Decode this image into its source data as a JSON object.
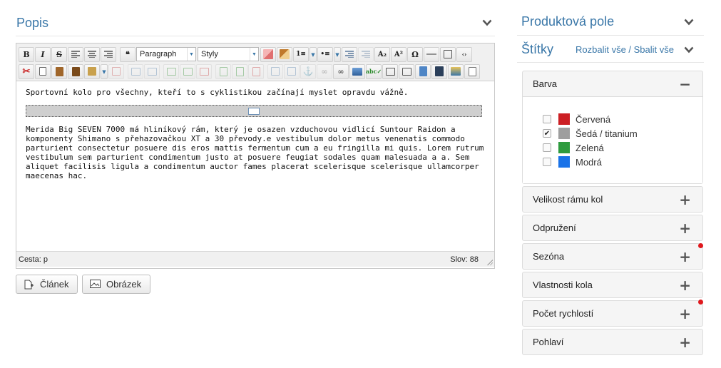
{
  "left": {
    "title": "Popis",
    "toolbar": {
      "format_select": "Paragraph",
      "style_select": "Styly"
    },
    "content": {
      "intro": "Sportovní kolo pro všechny, kteří to s cyklistikou začínají myslet opravdu vážně.",
      "body": "Merida Big SEVEN 7000 má hliníkový rám, který je osazen vzduchovou vidlicí Suntour Raidon a komponenty Shimano s přehazovačkou XT a 30 převody.e vestibulum dolor metus venenatis commodo parturient consectetur posuere dis eros mattis fermentum cum a eu fringilla mi quis. Lorem rutrum vestibulum sem parturient condimentum justo at posuere feugiat sodales quam malesuada a a. Sem aliquet facilisis ligula a condimentum auctor fames placerat scelerisque scelerisque ullamcorper maecenas hac."
    },
    "status": {
      "path": "Cesta: p",
      "words": "Slov: 88"
    },
    "buttons": {
      "article": "Článek",
      "image": "Obrázek"
    }
  },
  "right": {
    "product_fields_title": "Produktová pole",
    "tags_title": "Štítky",
    "expand_collapse_link": "Rozbalit vše / Sbalit vše",
    "color_panel": {
      "title": "Barva",
      "options": [
        {
          "label": "Červená",
          "color": "#cc1f24",
          "checked": false
        },
        {
          "label": "Šedá / titanium",
          "color": "#9e9e9e",
          "checked": true
        },
        {
          "label": "Zelená",
          "color": "#2e9b3e",
          "checked": false
        },
        {
          "label": "Modrá",
          "color": "#1a73e8",
          "checked": false
        }
      ]
    },
    "panels": [
      {
        "title": "Velikost rámu kol",
        "indicator": false
      },
      {
        "title": "Odpružení",
        "indicator": false
      },
      {
        "title": "Sezóna",
        "indicator": true
      },
      {
        "title": "Vlastnosti kola",
        "indicator": false
      },
      {
        "title": "Počet rychlostí",
        "indicator": true
      },
      {
        "title": "Pohlaví",
        "indicator": false
      }
    ]
  },
  "colors": {
    "accent": "#3a77a8",
    "indicator": "#e0181d"
  }
}
